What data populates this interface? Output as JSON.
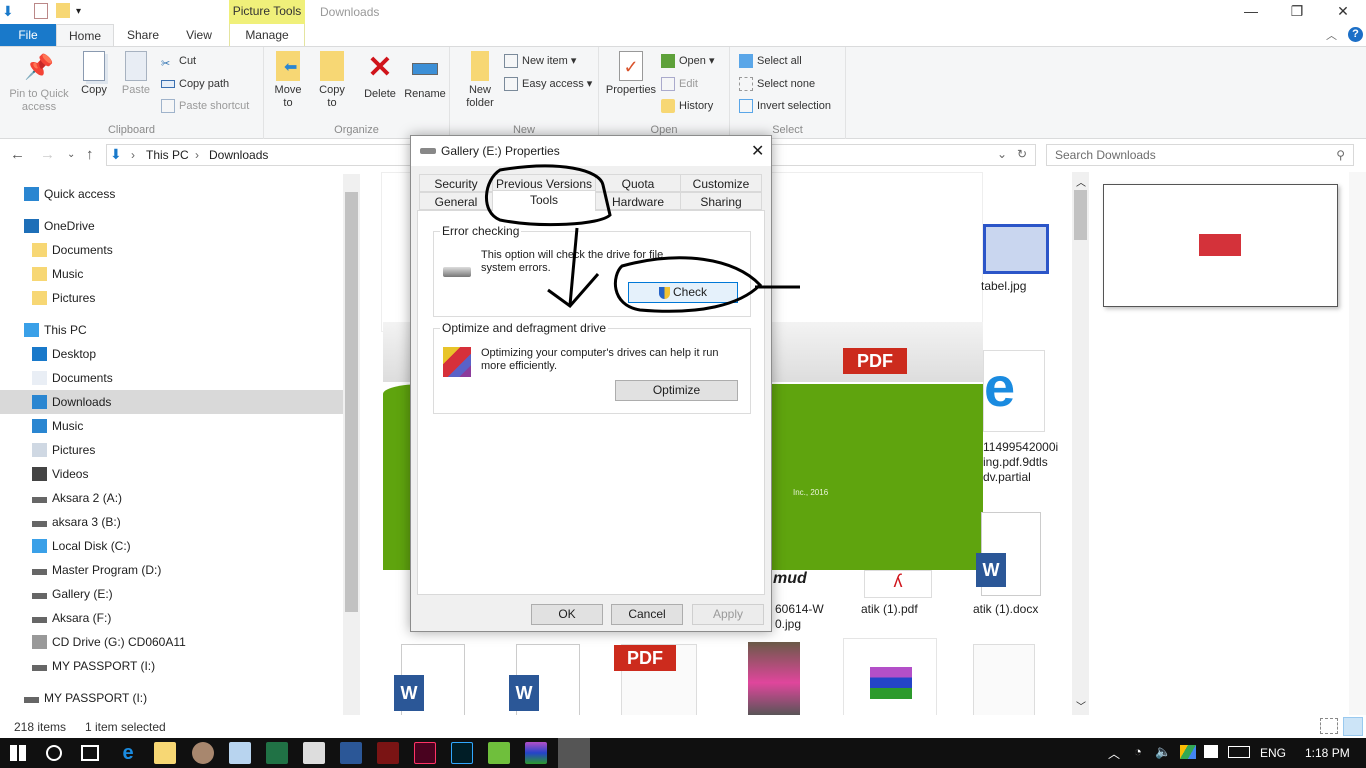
{
  "titlebar": {
    "window_title": "Downloads",
    "contextual_tab_group": "Picture Tools",
    "minimize": "—",
    "maximize": "❐",
    "close": "✕"
  },
  "ribbon_tabs": [
    {
      "label": "File"
    },
    {
      "label": "Home"
    },
    {
      "label": "Share"
    },
    {
      "label": "View"
    },
    {
      "label": "Manage"
    }
  ],
  "ribbon": {
    "clipboard": {
      "label": "Clipboard",
      "pin": "Pin to Quick access",
      "copy": "Copy",
      "paste": "Paste",
      "cut": "Cut",
      "copy_path": "Copy path",
      "paste_shortcut": "Paste shortcut"
    },
    "organize": {
      "label": "Organize",
      "move_to": "Move to",
      "copy_to": "Copy to",
      "delete": "Delete",
      "rename": "Rename"
    },
    "new": {
      "label": "New",
      "new_folder": "New folder",
      "new_item": "New item",
      "easy_access": "Easy access"
    },
    "open": {
      "label": "Open",
      "properties": "Properties",
      "open": "Open",
      "edit": "Edit",
      "history": "History"
    },
    "select": {
      "label": "Select",
      "select_all": "Select all",
      "select_none": "Select none",
      "invert": "Invert selection"
    }
  },
  "address": {
    "breadcrumb": [
      "This PC",
      "Downloads"
    ],
    "search_placeholder": "Search Downloads"
  },
  "nav_pane": {
    "items": [
      {
        "label": "Quick access",
        "icon": "star-icon"
      },
      {
        "label": "OneDrive",
        "icon": "onedrive-icon"
      },
      {
        "label": "Documents",
        "icon": "folder-synced-icon"
      },
      {
        "label": "Music",
        "icon": "folder-synced-icon"
      },
      {
        "label": "Pictures",
        "icon": "folder-synced-icon"
      },
      {
        "label": "This PC",
        "icon": "computer-icon"
      },
      {
        "label": "Desktop",
        "icon": "desktop-icon"
      },
      {
        "label": "Documents",
        "icon": "documents-icon"
      },
      {
        "label": "Downloads",
        "icon": "downloads-icon"
      },
      {
        "label": "Music",
        "icon": "music-icon"
      },
      {
        "label": "Pictures",
        "icon": "pictures-icon"
      },
      {
        "label": "Videos",
        "icon": "videos-icon"
      },
      {
        "label": "Aksara 2 (A:)",
        "icon": "drive-icon"
      },
      {
        "label": "aksara 3 (B:)",
        "icon": "drive-icon"
      },
      {
        "label": "Local Disk (C:)",
        "icon": "windows-drive-icon"
      },
      {
        "label": "Master Program (D:)",
        "icon": "drive-icon"
      },
      {
        "label": "Gallery (E:)",
        "icon": "drive-icon"
      },
      {
        "label": "Aksara  (F:)",
        "icon": "drive-icon"
      },
      {
        "label": "CD Drive (G:) CD060A11",
        "icon": "cd-drive-icon"
      },
      {
        "label": "MY PASSPORT (I:)",
        "icon": "drive-icon"
      },
      {
        "label": "MY PASSPORT (I:)",
        "icon": "drive-icon"
      }
    ],
    "selected": "Downloads"
  },
  "files": {
    "labels": [
      "tabel.jpg",
      "11499542000ing.pdf.9dtlsdv.partial",
      "60614-W0.jpg",
      "atik (1).pdf",
      "atik (1).docx"
    ],
    "partial_name_1": "11499542000i",
    "partial_name_2": "ing.pdf.9dtls",
    "partial_name_3": "dv.partial",
    "partial_name_4": "60614-W",
    "partial_name_5": "0.jpg",
    "pdf_badge": "PDF",
    "copyright_fragment": "Inc., 2016",
    "mud_fragment": "mud"
  },
  "status": {
    "item_count": "218 items",
    "selection": "1 item selected"
  },
  "dialog": {
    "title": "Gallery (E:) Properties",
    "tabs_row1": [
      "Security",
      "Previous Versions",
      "Quota",
      "Customize"
    ],
    "tabs_row2": [
      "General",
      "Tools",
      "Hardware",
      "Sharing"
    ],
    "active_tab": "Tools",
    "error_checking": {
      "legend": "Error checking",
      "text": "This option will check the drive for file system errors.",
      "button": "Check"
    },
    "optimize": {
      "legend": "Optimize and defragment drive",
      "text": "Optimizing your computer's drives can help it run more efficiently.",
      "button": "Optimize"
    },
    "ok": "OK",
    "cancel": "Cancel",
    "apply": "Apply"
  },
  "taskbar": {
    "apps": [
      "start",
      "cortana",
      "task-view",
      "edge",
      "file-explorer",
      "paint",
      "notepad",
      "excel",
      "calculator",
      "word",
      "acrobat",
      "indesign",
      "photoshop",
      "coreldraw",
      "winrar",
      "drive"
    ],
    "language": "ENG",
    "time": "1:18 PM"
  },
  "colors": {
    "accent": "#1979ca",
    "picture_tools": "#f0f07a",
    "green_overlay": "#5fa40e"
  }
}
